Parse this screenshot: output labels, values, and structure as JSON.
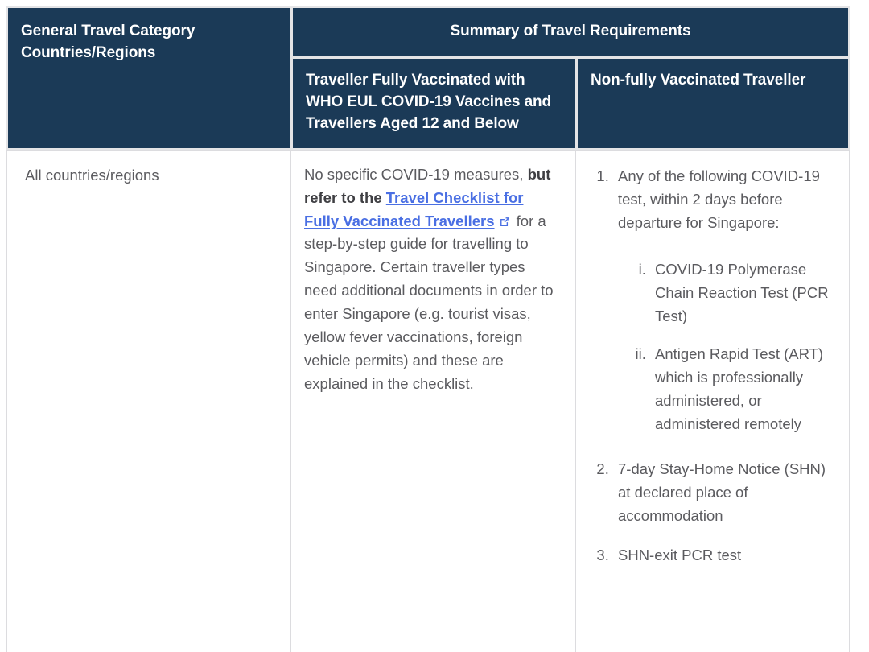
{
  "table": {
    "headers": {
      "category": "General Travel Category\nCountries/Regions",
      "category_line1": "General Travel Category",
      "category_line2": "Countries/Regions",
      "summary": "Summary of Travel Requirements",
      "vaccinated": "Traveller Fully Vaccinated with WHO EUL COVID-19 Vaccines and Travellers Aged 12 and Below",
      "non_vaccinated": "Non-fully Vaccinated Traveller"
    },
    "rows": [
      {
        "category": "All countries/regions",
        "vaccinated_cell": {
          "text_before_bold": "No specific COVID-19 measures, ",
          "bold_text": "but refer to the ",
          "link_text": "Travel Checklist for Fully Vaccinated Travellers",
          "link_icon": "external-link-icon",
          "text_after_link": " for a step-by-step guide for travelling to Singapore. Certain traveller types need additional documents in order to enter Singapore (e.g. tourist visas, yellow fever vaccinations, foreign vehicle permits) and these are explained in the checklist."
        },
        "non_vaccinated_cell": {
          "items": [
            {
              "text": "Any of the following COVID-19 test, within 2 days before departure for Singapore:",
              "subitems": [
                "COVID-19 Polymerase Chain Reaction Test (PCR Test)",
                "Antigen Rapid Test (ART) which is professionally administered, or administered remotely"
              ]
            },
            {
              "text": "7-day Stay-Home Notice (SHN) at declared place of accommodation",
              "subitems": []
            },
            {
              "text": "SHN-exit PCR test",
              "subitems": []
            }
          ]
        }
      }
    ]
  },
  "colors": {
    "header_bg": "#1b3a57",
    "header_text": "#ffffff",
    "body_text": "#5b5b5f",
    "link": "#4a6fe3",
    "border": "#dcdcdf",
    "header_border": "#e4e4e6"
  }
}
